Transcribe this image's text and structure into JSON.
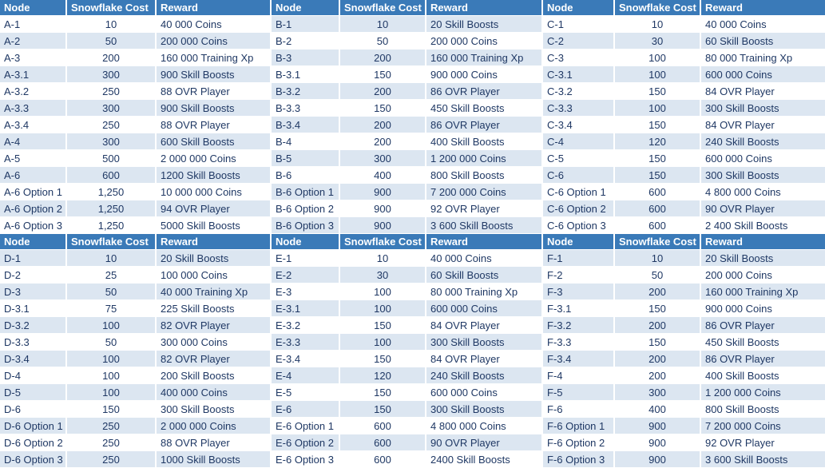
{
  "columns": {
    "node": "Node",
    "cost": "Snowflake Cost",
    "reward": "Reward"
  },
  "colors": {
    "header_bg": "#3a7ab8",
    "header_text": "#ffffff",
    "row_shade": "#dce6f1",
    "row_plain": "#ffffff",
    "body_text": "#1f3864",
    "grid": "#ffffff"
  },
  "blocks": [
    {
      "name": "block-abc",
      "groups": [
        {
          "name": "group-a",
          "first_row_shaded": false,
          "rows": [
            {
              "node": "A-1",
              "cost": "10",
              "reward": "40 000 Coins"
            },
            {
              "node": "A-2",
              "cost": "50",
              "reward": "200 000 Coins"
            },
            {
              "node": "A-3",
              "cost": "200",
              "reward": "160 000 Training Xp"
            },
            {
              "node": "A-3.1",
              "cost": "300",
              "reward": "900 Skill Boosts"
            },
            {
              "node": "A-3.2",
              "cost": "250",
              "reward": "88 OVR Player"
            },
            {
              "node": "A-3.3",
              "cost": "300",
              "reward": "900 Skill Boosts"
            },
            {
              "node": "A-3.4",
              "cost": "250",
              "reward": "88 OVR Player"
            },
            {
              "node": "A-4",
              "cost": "300",
              "reward": "600 Skill Boosts"
            },
            {
              "node": "A-5",
              "cost": "500",
              "reward": "2 000 000 Coins"
            },
            {
              "node": "A-6",
              "cost": "600",
              "reward": "1200 Skill Boosts"
            },
            {
              "node": "A-6 Option 1",
              "cost": "1,250",
              "reward": "10 000 000 Coins"
            },
            {
              "node": "A-6 Option 2",
              "cost": "1,250",
              "reward": "94 OVR Player"
            },
            {
              "node": "A-6 Option 3",
              "cost": "1,250",
              "reward": "5000 Skill Boosts"
            }
          ]
        },
        {
          "name": "group-b",
          "first_row_shaded": true,
          "rows": [
            {
              "node": "B-1",
              "cost": "10",
              "reward": "20 Skill Boosts"
            },
            {
              "node": "B-2",
              "cost": "50",
              "reward": "200 000 Coins"
            },
            {
              "node": "B-3",
              "cost": "200",
              "reward": "160 000 Training Xp"
            },
            {
              "node": "B-3.1",
              "cost": "150",
              "reward": "900 000 Coins"
            },
            {
              "node": "B-3.2",
              "cost": "200",
              "reward": "86 OVR Player"
            },
            {
              "node": "B-3.3",
              "cost": "150",
              "reward": "450 Skill Boosts"
            },
            {
              "node": "B-3.4",
              "cost": "200",
              "reward": "86 OVR Player"
            },
            {
              "node": "B-4",
              "cost": "200",
              "reward": "400 Skill Boosts"
            },
            {
              "node": "B-5",
              "cost": "300",
              "reward": "1 200 000 Coins"
            },
            {
              "node": "B-6",
              "cost": "400",
              "reward": "800 Skill Boosts"
            },
            {
              "node": "B-6 Option 1",
              "cost": "900",
              "reward": "7 200 000 Coins"
            },
            {
              "node": "B-6 Option 2",
              "cost": "900",
              "reward": "92 OVR Player"
            },
            {
              "node": "B-6 Option 3",
              "cost": "900",
              "reward": "3 600 Skill Boosts"
            }
          ]
        },
        {
          "name": "group-c",
          "first_row_shaded": false,
          "rows": [
            {
              "node": "C-1",
              "cost": "10",
              "reward": "40 000 Coins"
            },
            {
              "node": "C-2",
              "cost": "30",
              "reward": "60 Skill Boosts"
            },
            {
              "node": "C-3",
              "cost": "100",
              "reward": "80 000 Training Xp"
            },
            {
              "node": "C-3.1",
              "cost": "100",
              "reward": "600 000 Coins"
            },
            {
              "node": "C-3.2",
              "cost": "150",
              "reward": "84 OVR Player"
            },
            {
              "node": "C-3.3",
              "cost": "100",
              "reward": "300 Skill Boosts"
            },
            {
              "node": "C-3.4",
              "cost": "150",
              "reward": "84 OVR Player"
            },
            {
              "node": "C-4",
              "cost": "120",
              "reward": "240 Skill Boosts"
            },
            {
              "node": "C-5",
              "cost": "150",
              "reward": "600 000 Coins"
            },
            {
              "node": "C-6",
              "cost": "150",
              "reward": "300 Skill Boosts"
            },
            {
              "node": "C-6 Option 1",
              "cost": "600",
              "reward": "4 800 000 Coins"
            },
            {
              "node": "C-6 Option 2",
              "cost": "600",
              "reward": "90 OVR Player"
            },
            {
              "node": "C-6 Option 3",
              "cost": "600",
              "reward": "2 400 Skill Boosts"
            }
          ]
        }
      ]
    },
    {
      "name": "block-def",
      "groups": [
        {
          "name": "group-d",
          "first_row_shaded": true,
          "rows": [
            {
              "node": "D-1",
              "cost": "10",
              "reward": "20 Skill Boosts"
            },
            {
              "node": "D-2",
              "cost": "25",
              "reward": "100 000 Coins"
            },
            {
              "node": "D-3",
              "cost": "50",
              "reward": "40 000 Training Xp"
            },
            {
              "node": "D-3.1",
              "cost": "75",
              "reward": "225 Skill Boosts"
            },
            {
              "node": "D-3.2",
              "cost": "100",
              "reward": "82 OVR Player"
            },
            {
              "node": "D-3.3",
              "cost": "50",
              "reward": "300 000 Coins"
            },
            {
              "node": "D-3.4",
              "cost": "100",
              "reward": "82 OVR Player"
            },
            {
              "node": "D-4",
              "cost": "100",
              "reward": "200 Skill Boosts"
            },
            {
              "node": "D-5",
              "cost": "100",
              "reward": "400 000 Coins"
            },
            {
              "node": "D-6",
              "cost": "150",
              "reward": "300 Skill Boosts"
            },
            {
              "node": "D-6 Option 1",
              "cost": "250",
              "reward": "2 000 000 Coins"
            },
            {
              "node": "D-6 Option 2",
              "cost": "250",
              "reward": "88 OVR Player"
            },
            {
              "node": "D-6 Option 3",
              "cost": "250",
              "reward": "1000 Skill Boosts"
            }
          ]
        },
        {
          "name": "group-e",
          "first_row_shaded": false,
          "rows": [
            {
              "node": "E-1",
              "cost": "10",
              "reward": "40 000 Coins"
            },
            {
              "node": "E-2",
              "cost": "30",
              "reward": "60 Skill Boosts"
            },
            {
              "node": "E-3",
              "cost": "100",
              "reward": "80 000 Training Xp"
            },
            {
              "node": "E-3.1",
              "cost": "100",
              "reward": "600 000 Coins"
            },
            {
              "node": "E-3.2",
              "cost": "150",
              "reward": "84 OVR Player"
            },
            {
              "node": "E-3.3",
              "cost": "100",
              "reward": "300 Skill Boosts"
            },
            {
              "node": "E-3.4",
              "cost": "150",
              "reward": "84 OVR Player"
            },
            {
              "node": "E-4",
              "cost": "120",
              "reward": "240 Skill Boosts"
            },
            {
              "node": "E-5",
              "cost": "150",
              "reward": "600 000 Coins"
            },
            {
              "node": "E-6",
              "cost": "150",
              "reward": "300 Skill Boosts"
            },
            {
              "node": "E-6 Option 1",
              "cost": "600",
              "reward": "4 800 000 Coins"
            },
            {
              "node": "E-6 Option 2",
              "cost": "600",
              "reward": "90 OVR Player"
            },
            {
              "node": "E-6 Option 3",
              "cost": "600",
              "reward": "2400 Skill Boosts"
            }
          ]
        },
        {
          "name": "group-f",
          "first_row_shaded": true,
          "rows": [
            {
              "node": "F-1",
              "cost": "10",
              "reward": "20 Skill Boosts"
            },
            {
              "node": "F-2",
              "cost": "50",
              "reward": "200 000 Coins"
            },
            {
              "node": "F-3",
              "cost": "200",
              "reward": "160 000 Training Xp"
            },
            {
              "node": "F-3.1",
              "cost": "150",
              "reward": "900 000 Coins"
            },
            {
              "node": "F-3.2",
              "cost": "200",
              "reward": "86 OVR Player"
            },
            {
              "node": "F-3.3",
              "cost": "150",
              "reward": "450 Skill Boosts"
            },
            {
              "node": "F-3.4",
              "cost": "200",
              "reward": "86 OVR Player"
            },
            {
              "node": "F-4",
              "cost": "200",
              "reward": "400 Skill Boosts"
            },
            {
              "node": "F-5",
              "cost": "300",
              "reward": "1 200 000 Coins"
            },
            {
              "node": "F-6",
              "cost": "400",
              "reward": "800 Skill Boosts"
            },
            {
              "node": "F-6 Option 1",
              "cost": "900",
              "reward": "7 200 000 Coins"
            },
            {
              "node": "F-6 Option 2",
              "cost": "900",
              "reward": "92 OVR Player"
            },
            {
              "node": "F-6 Option 3",
              "cost": "900",
              "reward": "3 600 Skill Boosts"
            }
          ]
        }
      ]
    }
  ]
}
